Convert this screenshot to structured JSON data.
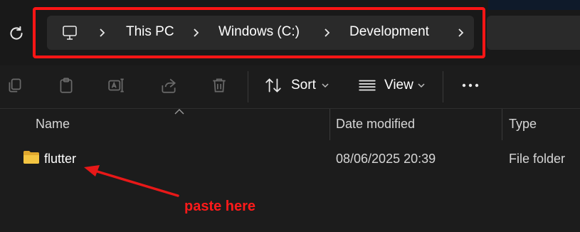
{
  "address_bar": {
    "crumbs": [
      "This PC",
      "Windows (C:)",
      "Development"
    ]
  },
  "toolbar": {
    "sort_label": "Sort",
    "view_label": "View",
    "icons": [
      "copy-icon",
      "paste-icon",
      "rename-icon",
      "share-icon",
      "delete-icon",
      "sort-icon",
      "view-icon",
      "more-icon"
    ]
  },
  "columns": {
    "name": "Name",
    "date_modified": "Date modified",
    "type": "Type"
  },
  "rows": [
    {
      "name": "flutter",
      "date_modified": "08/06/2025 20:39",
      "type": "File folder"
    }
  ],
  "annotation": {
    "text": "paste here",
    "color": "#ff1a1a"
  },
  "colors": {
    "background": "#1c1c1c",
    "address_bg": "#2a2a2a",
    "highlight_border": "#ff1515",
    "folder_yellow": "#f4c542"
  }
}
